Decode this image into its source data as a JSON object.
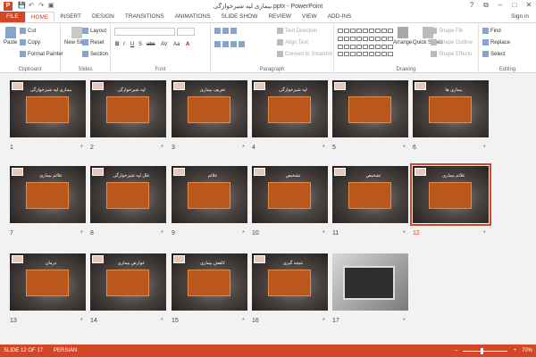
{
  "app": {
    "title": "بیماری لپه شیرخوارگی.pptx - PowerPoint",
    "logo": "P",
    "sign_in": "Sign in"
  },
  "window": {
    "help": "?",
    "restore": "⧉",
    "minimize": "–",
    "maximize": "□",
    "close": "✕"
  },
  "qat": [
    "💾",
    "↶",
    "↷",
    "▣"
  ],
  "tabs": [
    "FILE",
    "HOME",
    "INSERT",
    "DESIGN",
    "TRANSITIONS",
    "ANIMATIONS",
    "SLIDE SHOW",
    "REVIEW",
    "VIEW",
    "ADD-INS"
  ],
  "ribbon": {
    "clipboard": {
      "label": "Clipboard",
      "paste": "Paste",
      "cut": "Cut",
      "copy": "Copy",
      "format_painter": "Format Painter"
    },
    "slides": {
      "label": "Slides",
      "new_slide": "New Slide",
      "layout": "Layout",
      "reset": "Reset",
      "section": "Section"
    },
    "font": {
      "label": "Font",
      "bold": "B",
      "italic": "I",
      "underline": "U",
      "shadow": "S",
      "strike": "abc",
      "spacing": "AV",
      "case": "Aa",
      "color": "A"
    },
    "paragraph": {
      "label": "Paragraph",
      "text_direction": "Text Direction",
      "align_text": "Align Text",
      "convert": "Convert to SmartArt"
    },
    "drawing": {
      "label": "Drawing",
      "arrange": "Arrange",
      "quick_styles": "Quick Styles",
      "shape_fill": "Shape Fill",
      "shape_outline": "Shape Outline",
      "shape_effects": "Shape Effects"
    },
    "editing": {
      "label": "Editing",
      "find": "Find",
      "replace": "Replace",
      "select": "Select"
    }
  },
  "slides": [
    {
      "n": "1",
      "title": "بیماری لپه شیرخوارگی"
    },
    {
      "n": "2",
      "title": "لپه شیرخوارگی"
    },
    {
      "n": "3",
      "title": "تعریف بیماری"
    },
    {
      "n": "4",
      "title": "لپه شیرخوارگی"
    },
    {
      "n": "5",
      "title": ""
    },
    {
      "n": "6",
      "title": "بیماری ها"
    },
    {
      "n": "7",
      "title": "علائم بیماری"
    },
    {
      "n": "8",
      "title": "علل لپه شیرخوارگی"
    },
    {
      "n": "9",
      "title": "علائم"
    },
    {
      "n": "10",
      "title": "تشخیص"
    },
    {
      "n": "11",
      "title": "تشخیص"
    },
    {
      "n": "12",
      "title": "علائم بیماری"
    },
    {
      "n": "13",
      "title": "درمان"
    },
    {
      "n": "14",
      "title": "عوارض بیماری"
    },
    {
      "n": "15",
      "title": "کاهش بیماری"
    },
    {
      "n": "16",
      "title": "نتیجه گیری"
    },
    {
      "n": "17",
      "title": ""
    }
  ],
  "selected_slide": "12",
  "slide_mark": "*",
  "status": {
    "slide_of": "SLIDE 12 OF 17",
    "language": "PERSIAN",
    "zoom_minus": "–",
    "zoom_plus": "+",
    "zoom": "70%"
  },
  "colors": {
    "accent": "#d24726",
    "slide_orange": "#e07c2a"
  }
}
